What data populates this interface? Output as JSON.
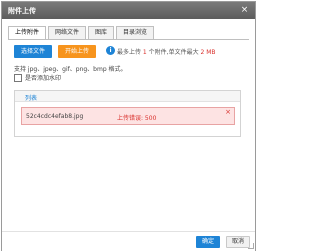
{
  "dialog": {
    "title": "附件上传",
    "close_glyph": "×"
  },
  "tabs": [
    {
      "label": "上传附件",
      "active": true
    },
    {
      "label": "网络文件",
      "active": false
    },
    {
      "label": "图库",
      "active": false
    },
    {
      "label": "目录浏览",
      "active": false
    }
  ],
  "toolbar": {
    "select_label": "选择文件",
    "upload_label": "开始上传",
    "info_glyph": "i",
    "limit_prefix": "最多上传 ",
    "limit_count": "1",
    "limit_middle": " 个附件,单文件最大 ",
    "limit_size": "2 MB"
  },
  "file_types": "支持 jpg、jpeg、gif、png、bmp 格式。",
  "watermark": {
    "label": "是否添加水印",
    "checked": false
  },
  "list": {
    "title": "列表",
    "files": [
      {
        "name": "52c4cdc4efab8.jpg",
        "status": "上传错误: 500",
        "remove_glyph": "×"
      }
    ]
  },
  "footer": {
    "ok_label": "确定",
    "cancel_label": "取消"
  },
  "colors": {
    "accent": "#1e84d6",
    "upload": "#f7941d",
    "error": "#d9302c",
    "titlebar": "#666666"
  },
  "icons": {
    "close": "close-icon",
    "info": "info-icon",
    "remove": "remove-icon",
    "resize": "resize-grip-icon"
  }
}
